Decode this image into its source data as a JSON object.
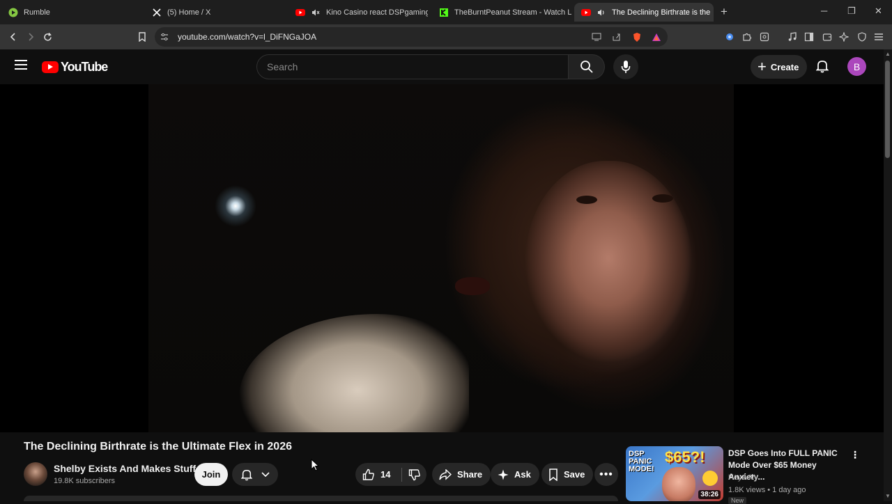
{
  "browser": {
    "tabs": [
      {
        "title": "Rumble",
        "icon": "rumble-icon"
      },
      {
        "title": "(5) Home / X",
        "icon": "x-icon"
      },
      {
        "title": "Kino Casino react DSPgamings W",
        "icon": "youtube-icon"
      },
      {
        "title": "TheBurntPeanut Stream - Watch Live",
        "icon": "kick-icon"
      },
      {
        "title": "The Declining Birthrate is the",
        "icon": "youtube-icon"
      }
    ],
    "url": "youtube.com/watch?v=l_DiFNGaJOA"
  },
  "masthead": {
    "logo_text": "YouTube",
    "search_placeholder": "Search",
    "create_label": "Create",
    "avatar_letter": "B"
  },
  "video": {
    "title": "The Declining Birthrate is the Ultimate Flex in 2026",
    "channel_name": "Shelby Exists And Makes Stuff",
    "subscribers": "19.8K subscribers",
    "join_label": "Join",
    "like_count": "14",
    "share_label": "Share",
    "ask_label": "Ask",
    "save_label": "Save"
  },
  "recommended": [
    {
      "title": "DSP Goes Into FULL PANIC Mode Over $65 Money Anxiety...",
      "channel": "HeyArVy",
      "meta": "1.8K views • 1 day ago",
      "duration": "38:26",
      "badge": "New",
      "thumb_text_1": "DSP PANIC MODE!",
      "thumb_text_2": "$65?!"
    }
  ],
  "colors": {
    "youtube_red": "#ff0000",
    "avatar_purple": "#ab47bc",
    "background": "#0f0f0f"
  }
}
